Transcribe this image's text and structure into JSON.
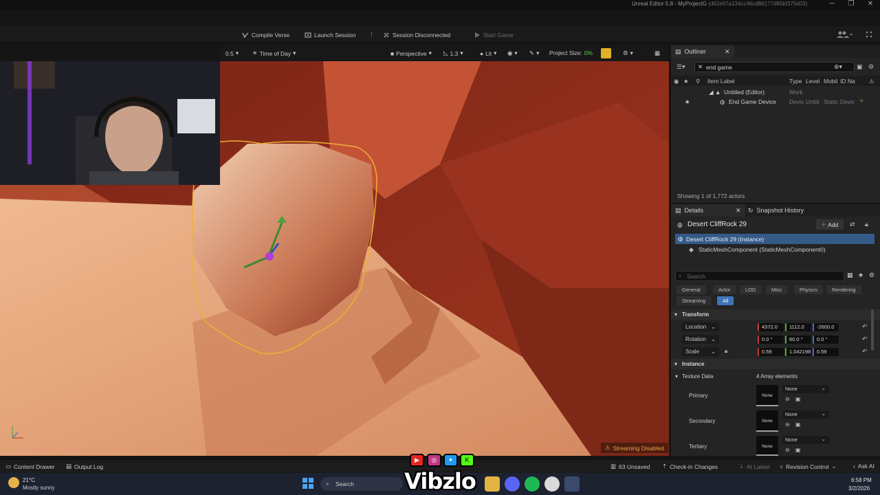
{
  "window": {
    "title": "Unreal Editor 5.8 - MyProjectG",
    "hash": "(d62e07a134cc46cd86177d85bf375d03)",
    "minimize": "─",
    "restore": "❐",
    "close": "✕"
  },
  "toolbar": {
    "compile_verse": "Compile Verse",
    "launch_session": "Launch Session",
    "session_status": "Session Disconnected",
    "start_game": "Start Game",
    "more": "⋮"
  },
  "viewport_bar": {
    "speed": "0.5",
    "time_of_day": "Time of Day",
    "perspective": "Perspective",
    "fov": "1.3",
    "lit": "Lit",
    "project_size_label": "Project Size:",
    "project_size_value": "0%"
  },
  "viewport": {
    "streaming_badge": "Streaming Disabled"
  },
  "outliner": {
    "tab_label": "Outliner",
    "search_value": "end game",
    "columns": [
      "Item Label",
      "Type",
      "Level",
      "Mobil",
      "ID Na"
    ],
    "rows": [
      {
        "label": "Untitled (Editor)",
        "type": "Work"
      },
      {
        "label": "End Game Device",
        "type": "Devic",
        "level": "Untitl",
        "mobility": "Static",
        "id": "Devic"
      }
    ],
    "actor_count": "Showing 1 of 1,772 actors"
  },
  "details": {
    "tab_label": "Details",
    "snapshot_tab": "Snapshot History",
    "actor_name": "Desert CliffRock 29",
    "add_label": "Add",
    "instance_label": "Desert CliffRock 29 (Instance)",
    "component_label": "StaticMeshComponent (StaticMeshComponent0)",
    "search_placeholder": "Search",
    "categories": [
      "General",
      "Actor",
      "LOD",
      "Misc",
      "Physics",
      "Rendering",
      "Streaming",
      "All"
    ],
    "transform_section": "Transform",
    "transform": {
      "location": {
        "label": "Location",
        "x": "4372.0",
        "y": "1112.0",
        "z": "-2600.0"
      },
      "rotation": {
        "label": "Rotation",
        "x": "0.0 °",
        "y": "60.0 °",
        "z": "0.0 °"
      },
      "scale": {
        "label": "Scale",
        "x": "0.59",
        "y": "1.042198",
        "z": "0.59"
      }
    },
    "instance_section": "Instance",
    "texture_data": {
      "label": "Texture Data",
      "count": "4 Array elements",
      "slots": [
        {
          "name": "Primary",
          "thumb": "None",
          "value": "None"
        },
        {
          "name": "Secondary",
          "thumb": "None",
          "value": "None"
        },
        {
          "name": "Tertiary",
          "thumb": "None",
          "value": "None"
        }
      ]
    }
  },
  "statusbar": {
    "content_drawer": "Content Drawer",
    "output_log": "Output Log",
    "unsaved": "63 Unsaved",
    "check_in": "Check-in Changes",
    "at_latest": "At Latest",
    "revision_control": "Revision Control",
    "ask_ai": "Ask AI"
  },
  "taskbar": {
    "temperature": "21°C",
    "weather": "Mostly sunny",
    "search_label": "Search",
    "time": "6:58 PM",
    "date": "3/2/2026"
  },
  "overlay": {
    "logo_text": "Vibzlo"
  },
  "colors": {
    "accent_blue": "#3f74b8",
    "selection_blue": "#355a88",
    "warning_orange": "#e9a640",
    "perf_yellow": "#e2b126",
    "rock_red": "#8c2a1a",
    "sand": "#e3a27a"
  }
}
